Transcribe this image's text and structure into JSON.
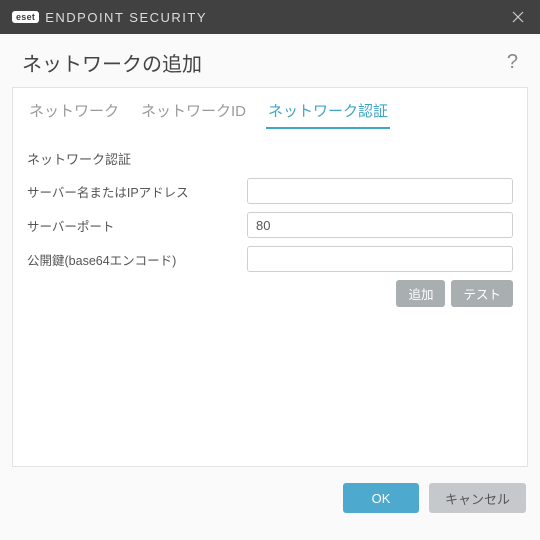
{
  "titlebar": {
    "brand_badge": "eset",
    "brand_text": "ENDPOINT SECURITY"
  },
  "header": {
    "title": "ネットワークの追加",
    "help": "?"
  },
  "tabs": [
    {
      "label": "ネットワーク",
      "active": false
    },
    {
      "label": "ネットワークID",
      "active": false
    },
    {
      "label": "ネットワーク認証",
      "active": true
    }
  ],
  "section": {
    "title": "ネットワーク認証"
  },
  "fields": {
    "server": {
      "label": "サーバー名またはIPアドレス",
      "value": ""
    },
    "port": {
      "label": "サーバーポート",
      "value": "80"
    },
    "pubkey": {
      "label": "公開鍵(base64エンコード)",
      "value": ""
    }
  },
  "buttons": {
    "add": "追加",
    "test": "テスト",
    "ok": "OK",
    "cancel": "キャンセル"
  }
}
